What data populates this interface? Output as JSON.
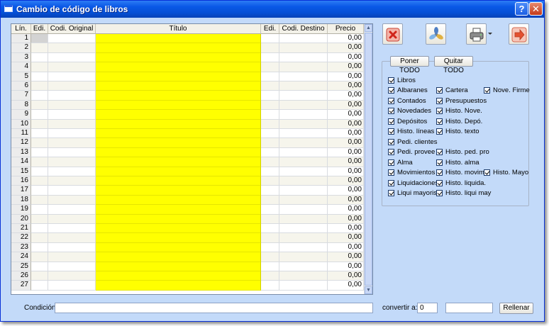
{
  "window": {
    "title": "Cambio de código de libros",
    "help_glyph": "?",
    "close_glyph": "✕"
  },
  "grid": {
    "columns": [
      "Lín.",
      "Edi.",
      "Codi. Original",
      "Título",
      "Edi.",
      "Codi. Destino",
      "Precio"
    ],
    "rows": [
      {
        "lin": "1",
        "precio": "0,00"
      },
      {
        "lin": "2",
        "precio": "0,00"
      },
      {
        "lin": "3",
        "precio": "0,00"
      },
      {
        "lin": "4",
        "precio": "0,00"
      },
      {
        "lin": "5",
        "precio": "0,00"
      },
      {
        "lin": "6",
        "precio": "0,00"
      },
      {
        "lin": "7",
        "precio": "0,00"
      },
      {
        "lin": "8",
        "precio": "0,00"
      },
      {
        "lin": "9",
        "precio": "0,00"
      },
      {
        "lin": "10",
        "precio": "0,00"
      },
      {
        "lin": "11",
        "precio": "0,00"
      },
      {
        "lin": "12",
        "precio": "0,00"
      },
      {
        "lin": "13",
        "precio": "0,00"
      },
      {
        "lin": "14",
        "precio": "0,00"
      },
      {
        "lin": "15",
        "precio": "0,00"
      },
      {
        "lin": "16",
        "precio": "0,00"
      },
      {
        "lin": "17",
        "precio": "0,00"
      },
      {
        "lin": "18",
        "precio": "0,00"
      },
      {
        "lin": "19",
        "precio": "0,00"
      },
      {
        "lin": "20",
        "precio": "0,00"
      },
      {
        "lin": "21",
        "precio": "0,00"
      },
      {
        "lin": "22",
        "precio": "0,00"
      },
      {
        "lin": "23",
        "precio": "0,00"
      },
      {
        "lin": "24",
        "precio": "0,00"
      },
      {
        "lin": "25",
        "precio": "0,00"
      },
      {
        "lin": "26",
        "precio": "0,00"
      },
      {
        "lin": "27",
        "precio": "0,00"
      }
    ]
  },
  "toolbar": {
    "cancel_icon": "cancel-x-icon",
    "fan_icon": "fan-icon",
    "print_icon": "printer-icon",
    "exit_icon": "exit-arrow-icon"
  },
  "options": {
    "poner_label": "Poner TODO",
    "quitar_label": "Quitar TODO",
    "checks": [
      {
        "key": "libros",
        "label": "Libros",
        "checked": true
      },
      {
        "key": "albaranes",
        "label": "Albaranes",
        "checked": true
      },
      {
        "key": "cartera",
        "label": "Cartera",
        "checked": true
      },
      {
        "key": "nove_firme",
        "label": "Nove. Firme",
        "checked": true
      },
      {
        "key": "contados",
        "label": "Contados",
        "checked": true
      },
      {
        "key": "presupuestos",
        "label": "Presupuestos",
        "checked": true
      },
      {
        "key": "novedades",
        "label": "Novedades",
        "checked": true
      },
      {
        "key": "histo_nove",
        "label": "Histo. Nove.",
        "checked": true
      },
      {
        "key": "depositos",
        "label": "Depósitos",
        "checked": true
      },
      {
        "key": "histo_depo",
        "label": "Histo. Depó.",
        "checked": true
      },
      {
        "key": "histo_lineas",
        "label": "Histo. líneas",
        "checked": true
      },
      {
        "key": "histo_texto",
        "label": "Histo. texto",
        "checked": true
      },
      {
        "key": "pedi_clientes",
        "label": "Pedi. clientes",
        "checked": true
      },
      {
        "key": "pedi_provee",
        "label": "Pedi. provee",
        "checked": true
      },
      {
        "key": "histo_ped_pro",
        "label": "Histo. ped. pro",
        "checked": true
      },
      {
        "key": "alma",
        "label": "Alma",
        "checked": true
      },
      {
        "key": "histo_alma",
        "label": "Histo. alma",
        "checked": true
      },
      {
        "key": "movimientos",
        "label": "Movimientos",
        "checked": true
      },
      {
        "key": "histo_movim",
        "label": "Histo. movim",
        "checked": true
      },
      {
        "key": "histo_mayo",
        "label": "Histo. Mayo",
        "checked": true
      },
      {
        "key": "liquidaciones",
        "label": "Liquidaciones",
        "checked": true
      },
      {
        "key": "histo_liquida",
        "label": "Histo. liquida.",
        "checked": true
      },
      {
        "key": "liqui_mayorista",
        "label": "Liqui mayorista",
        "checked": true
      },
      {
        "key": "histo_liqui_may",
        "label": "Histo. liqui may",
        "checked": true
      }
    ]
  },
  "bottom": {
    "condicion_label": "Condición:",
    "condicion_value": "",
    "convertir_label": "convertir a:",
    "convertir_value": "0",
    "fill_value": "",
    "rellenar_label": "Rellenar"
  }
}
